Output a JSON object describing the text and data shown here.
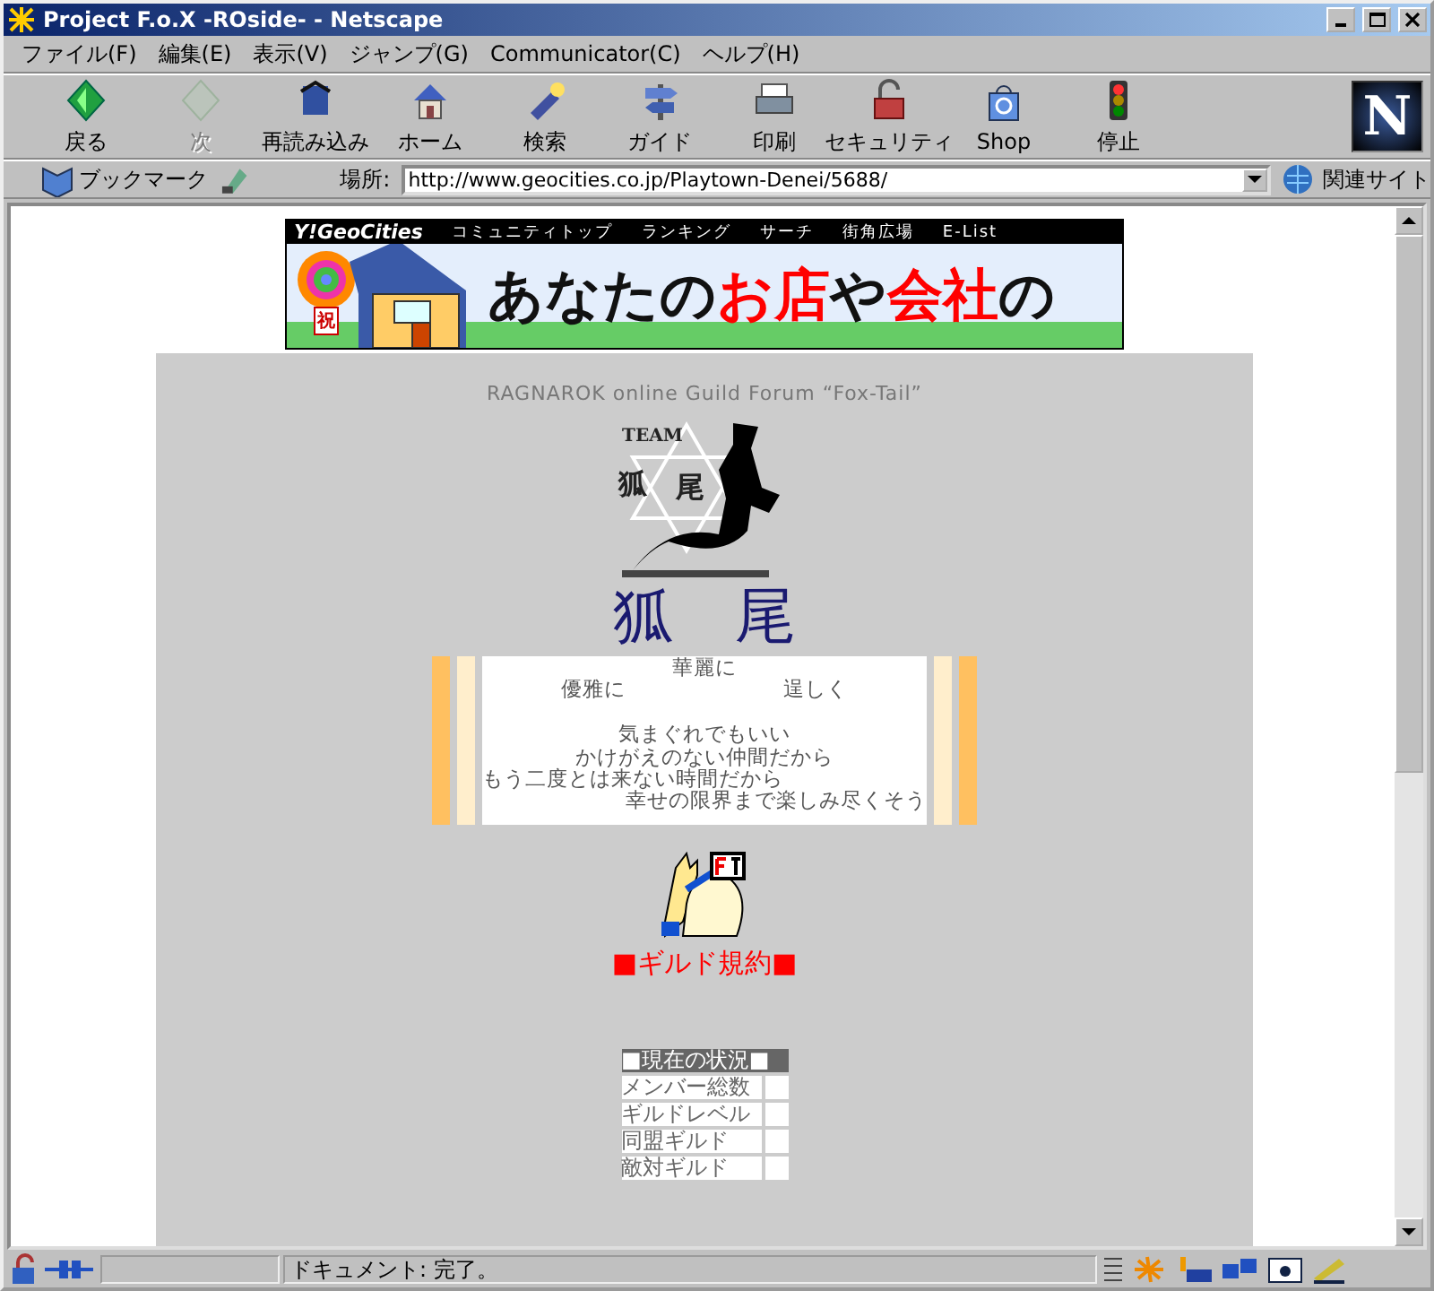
{
  "window": {
    "title": "Project F.o.X -ROside- - Netscape"
  },
  "menu": [
    "ファイル(F)",
    "編集(E)",
    "表示(V)",
    "ジャンプ(G)",
    "Communicator(C)",
    "ヘルプ(H)"
  ],
  "toolbar": [
    {
      "label": "戻る",
      "disabled": false
    },
    {
      "label": "次",
      "disabled": true
    },
    {
      "label": "再読み込み",
      "disabled": false
    },
    {
      "label": "ホーム",
      "disabled": false
    },
    {
      "label": "検索",
      "disabled": false
    },
    {
      "label": "ガイド",
      "disabled": false
    },
    {
      "label": "印刷",
      "disabled": false
    },
    {
      "label": "セキュリティ",
      "disabled": false
    },
    {
      "label": "Shop",
      "disabled": false
    },
    {
      "label": "停止",
      "disabled": false
    }
  ],
  "logo": "N",
  "location_bar": {
    "bookmarks": "ブックマーク",
    "label": "場所:",
    "url": "http://www.geocities.co.jp/Playtown-Denei/5688/",
    "related": "関連サイト"
  },
  "banner": {
    "brand": "Y!GeoCities",
    "links": [
      "コミュニティトップ",
      "ランキング",
      "サーチ",
      "街角広場",
      "E-List"
    ],
    "sign": "祝",
    "ad_text": [
      {
        "text": "あなたの",
        "highlight": false
      },
      {
        "text": "お店",
        "highlight": true
      },
      {
        "text": "や",
        "highlight": false
      },
      {
        "text": "会社",
        "highlight": true
      },
      {
        "text": "の",
        "highlight": false
      }
    ]
  },
  "page": {
    "subtitle": "RAGNAROK online Guild Forum “Fox-Tail”",
    "logo_texts": {
      "team": "TEAM",
      "left": "狐",
      "right": "尾"
    },
    "title": "狐　尾",
    "poem": [
      {
        "kind": "center",
        "parts": [
          "華麗に"
        ]
      },
      {
        "kind": "split",
        "parts": [
          "優雅に",
          "逞しく"
        ]
      },
      {
        "kind": "blank"
      },
      {
        "kind": "center",
        "parts": [
          "気まぐれでもいい"
        ]
      },
      {
        "kind": "center",
        "parts": [
          "かけがえのない仲間だから"
        ]
      },
      {
        "kind": "left",
        "parts": [
          "もう二度とは来ない時間だから"
        ]
      },
      {
        "kind": "right",
        "parts": [
          "幸せの限界まで楽しみ尽くそう"
        ]
      }
    ],
    "rules_link": "■ギルド規約■",
    "status_table": {
      "header": "■現在の状況■",
      "rows": [
        "メンバー総数",
        "ギルドレベル",
        "同盟ギルド",
        "敵対ギルド"
      ]
    }
  },
  "status_bar": {
    "text": "ドキュメント: 完了。"
  }
}
